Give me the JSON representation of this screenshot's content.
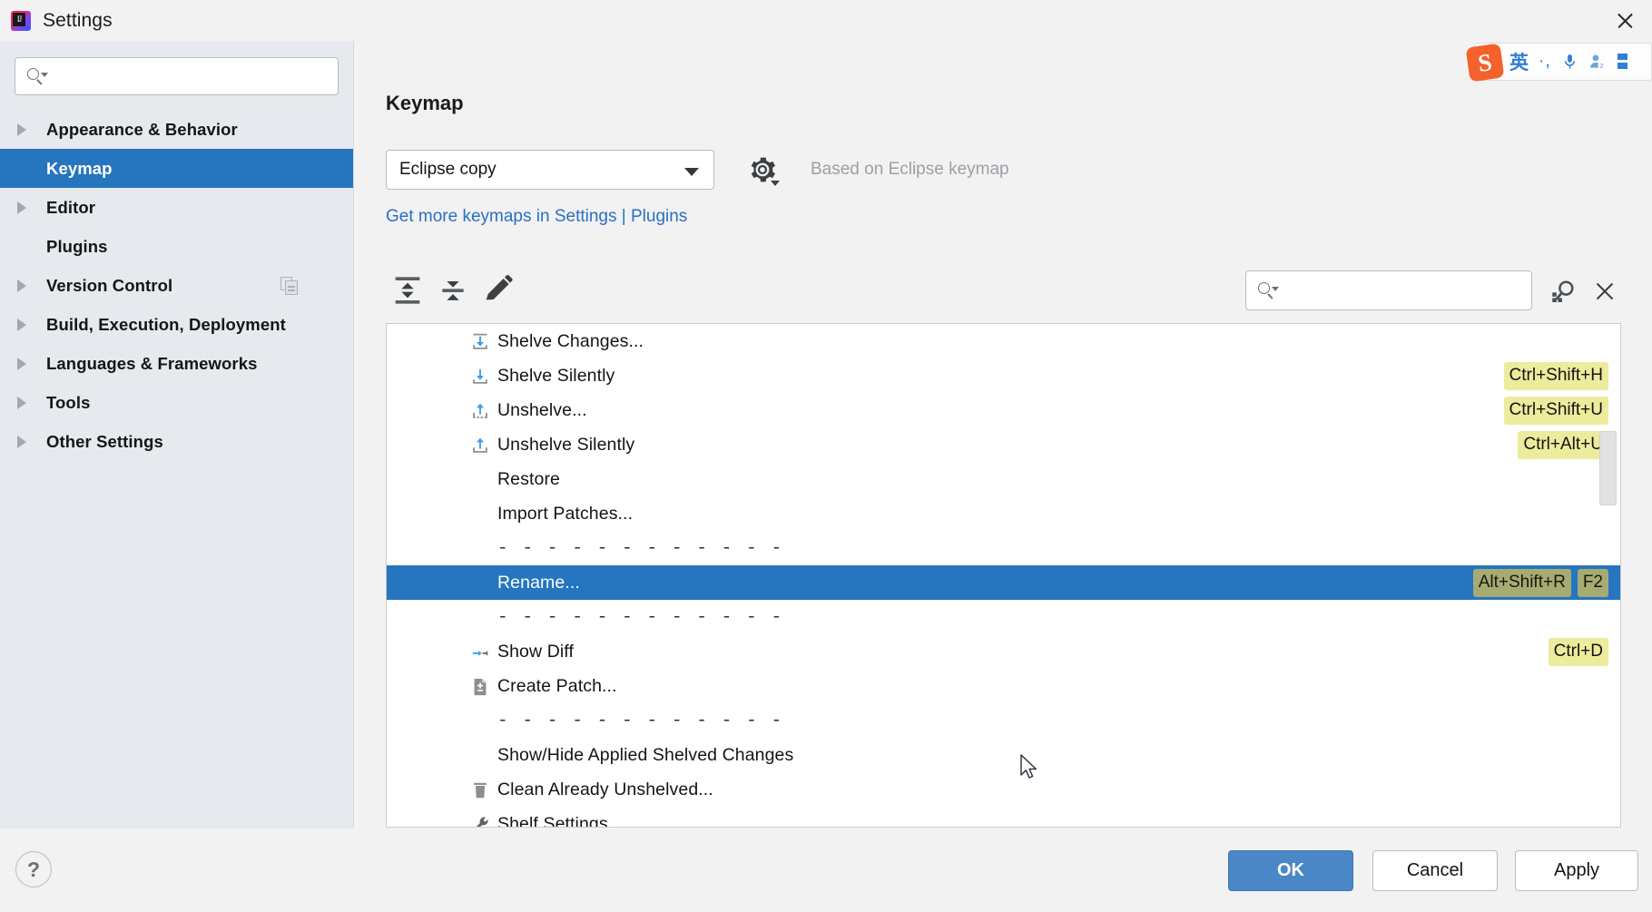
{
  "window": {
    "title": "Settings",
    "logo_icon": "intellij-idea-logo",
    "close_icon": "close-icon"
  },
  "sidebar": {
    "search": {
      "value": "",
      "placeholder": "",
      "icon": "search-icon"
    },
    "items": [
      {
        "label": "Appearance & Behavior",
        "expandable": true,
        "selected": false
      },
      {
        "label": "Keymap",
        "expandable": false,
        "selected": true
      },
      {
        "label": "Editor",
        "expandable": true,
        "selected": false
      },
      {
        "label": "Plugins",
        "expandable": false,
        "selected": false
      },
      {
        "label": "Version Control",
        "expandable": true,
        "selected": false,
        "badge_icon": "copy-icon"
      },
      {
        "label": "Build, Execution, Deployment",
        "expandable": true,
        "selected": false
      },
      {
        "label": "Languages & Frameworks",
        "expandable": true,
        "selected": false
      },
      {
        "label": "Tools",
        "expandable": true,
        "selected": false
      },
      {
        "label": "Other Settings",
        "expandable": true,
        "selected": false
      }
    ]
  },
  "main": {
    "page_title": "Keymap",
    "keymap_select": {
      "value": "Eclipse copy",
      "arrow_icon": "chevron-down-icon"
    },
    "gear_icon": "gear-icon",
    "based_on_text": "Based on Eclipse keymap",
    "plugins_link": "Get more keymaps in Settings | Plugins",
    "toolbar": {
      "expand_all_icon": "expand-all-icon",
      "collapse_all_icon": "collapse-all-icon",
      "edit_icon": "pencil-edit-icon",
      "find_field": {
        "value": "",
        "placeholder": "",
        "icon": "search-icon"
      },
      "find_by_shortcut_icon": "find-by-shortcut-icon",
      "clear_icon": "close-icon"
    },
    "actions": [
      {
        "label": "Shelve Changes...",
        "icon": "shelve-changes-icon",
        "shortcuts": [],
        "separator": false,
        "selected": false
      },
      {
        "label": "Shelve Silently",
        "icon": "shelve-silently-icon",
        "shortcuts": [
          "Ctrl+Shift+H"
        ],
        "separator": false,
        "selected": false
      },
      {
        "label": "Unshelve...",
        "icon": "unshelve-icon",
        "shortcuts": [
          "Ctrl+Shift+U"
        ],
        "separator": false,
        "selected": false
      },
      {
        "label": "Unshelve Silently",
        "icon": "unshelve-silently-icon",
        "shortcuts": [
          "Ctrl+Alt+U"
        ],
        "separator": false,
        "selected": false
      },
      {
        "label": "Restore",
        "icon": "",
        "shortcuts": [],
        "separator": false,
        "selected": false
      },
      {
        "label": "Import Patches...",
        "icon": "",
        "shortcuts": [],
        "separator": false,
        "selected": false
      },
      {
        "label": "- - - - - - - - - - - -",
        "icon": "",
        "shortcuts": [],
        "separator": true,
        "selected": false
      },
      {
        "label": "Rename...",
        "icon": "",
        "shortcuts": [
          "Alt+Shift+R",
          "F2"
        ],
        "separator": false,
        "selected": true
      },
      {
        "label": "- - - - - - - - - - - -",
        "icon": "",
        "shortcuts": [],
        "separator": true,
        "selected": false
      },
      {
        "label": "Show Diff",
        "icon": "show-diff-icon",
        "shortcuts": [
          "Ctrl+D"
        ],
        "separator": false,
        "selected": false
      },
      {
        "label": "Create Patch...",
        "icon": "create-patch-icon",
        "shortcuts": [],
        "separator": false,
        "selected": false
      },
      {
        "label": "- - - - - - - - - - - -",
        "icon": "",
        "shortcuts": [],
        "separator": true,
        "selected": false
      },
      {
        "label": "Show/Hide Applied Shelved Changes",
        "icon": "",
        "shortcuts": [],
        "separator": false,
        "selected": false
      },
      {
        "label": "Clean Already Unshelved...",
        "icon": "trash-icon",
        "shortcuts": [],
        "separator": false,
        "selected": false
      },
      {
        "label": "Shelf Settings",
        "icon": "wrench-icon",
        "shortcuts": [],
        "separator": false,
        "selected": false
      }
    ]
  },
  "footer": {
    "help_label": "?",
    "ok_label": "OK",
    "cancel_label": "Cancel",
    "apply_label": "Apply"
  },
  "ime": {
    "logo_text": "S",
    "mode_label": "英",
    "punctuation_label": "·,",
    "mic_icon": "microphone-icon",
    "user_icon": "user-icon",
    "menu_icon": "menu-grid-icon"
  },
  "colors": {
    "selection_blue": "#2675bf",
    "link_blue": "#2a6fc4",
    "shortcut_yellow": "#ecec9c",
    "ok_button_blue": "#4a87c7"
  }
}
